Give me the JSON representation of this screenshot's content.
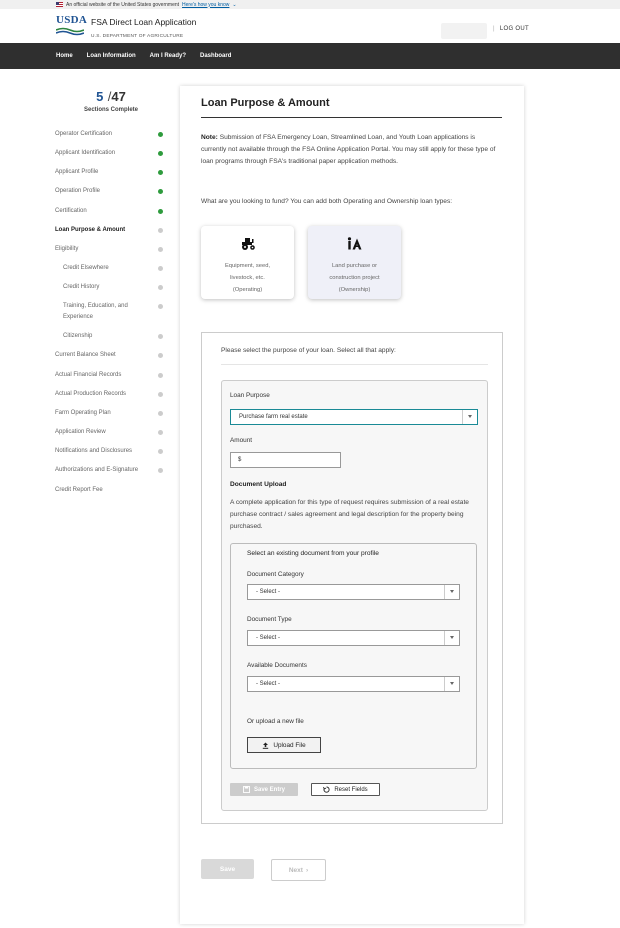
{
  "gov_banner": {
    "text": "An official website of the United States government",
    "link": "Here's how you know"
  },
  "header": {
    "logo": "USDA",
    "app_title": "FSA Direct Loan Application",
    "department": "U.S. DEPARTMENT OF AGRICULTURE",
    "logout": "LOG OUT"
  },
  "nav": {
    "items": [
      "Home",
      "Loan Information",
      "Am I Ready?",
      "Dashboard"
    ]
  },
  "progress": {
    "done": "5",
    "sep": "/",
    "total": "47",
    "label": "Sections Complete"
  },
  "sidebar": {
    "steps": [
      {
        "label": "Operator Certification",
        "status": "complete"
      },
      {
        "label": "Applicant Identification",
        "status": "complete"
      },
      {
        "label": "Applicant Profile",
        "status": "complete"
      },
      {
        "label": "Operation Profile",
        "status": "complete"
      },
      {
        "label": "Certification",
        "status": "complete"
      },
      {
        "label": "Loan Purpose & Amount",
        "status": "active"
      },
      {
        "label": "Eligibility",
        "status": "incomplete"
      },
      {
        "label": "Credit Elsewhere",
        "status": "incomplete"
      },
      {
        "label": "Credit History",
        "status": "incomplete"
      },
      {
        "label": "Training, Education, and",
        "label2": "Experience",
        "status": "incomplete"
      },
      {
        "label": "Citizenship",
        "status": "incomplete"
      },
      {
        "label": "Current Balance Sheet",
        "status": "incomplete"
      },
      {
        "label": "Actual Financial Records",
        "status": "incomplete"
      },
      {
        "label": "Actual Production Records",
        "status": "incomplete"
      },
      {
        "label": "Farm Operating Plan",
        "status": "incomplete"
      },
      {
        "label": "Application Review",
        "status": "incomplete"
      },
      {
        "label": "Notifications and Disclosures",
        "status": "incomplete"
      },
      {
        "label": "Authorizations and E-Signature",
        "status": "incomplete"
      },
      {
        "label": "Credit Report Fee",
        "status": "none"
      }
    ]
  },
  "main": {
    "title": "Loan Purpose & Amount",
    "note_label": "Note:",
    "note_text": "Submission of FSA Emergency Loan, Streamlined Loan, and Youth Loan applications is currently not available through the FSA Online Application Portal. You may still apply for these type of loan programs through FSA's traditional paper application methods.",
    "question": "What are you looking to fund? You can add both Operating and Ownership loan types:",
    "tiles": [
      {
        "line1": "Equipment, seed,",
        "line2": "livestock, etc.",
        "line3": "(Operating)",
        "icon": "tractor-icon"
      },
      {
        "line1": "Land purchase or",
        "line2": "construction project",
        "line3": "(Ownership)",
        "icon": "land-icon"
      }
    ],
    "purpose_intro": "Please select the purpose of your loan. Select all that apply:",
    "loan_purpose_label": "Loan Purpose",
    "loan_purpose_value": "Purchase farm real estate",
    "amount_label": "Amount",
    "amount_value": "$",
    "doc_upload_title": "Document Upload",
    "doc_upload_text": "A complete application for this type of request requires submission of a real estate purchase contract / sales agreement and legal description for the property being purchased.",
    "existing_doc_title": "Select an existing document from your profile",
    "doc_category_label": "Document Category",
    "doc_type_label": "Document Type",
    "available_docs_label": "Available Documents",
    "select_placeholder": "- Select -",
    "upload_new_label": "Or upload a new file",
    "upload_button": "Upload File",
    "save_entry_button": "Save Entry",
    "reset_button": "Reset Fields",
    "save_button": "Save",
    "next_button": "Next"
  }
}
